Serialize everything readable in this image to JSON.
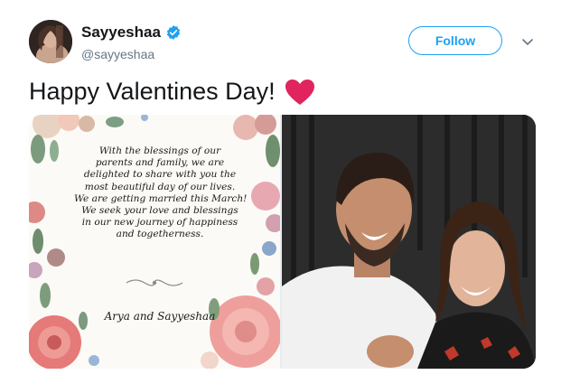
{
  "tweet": {
    "display_name": "Sayyeshaa",
    "handle": "@sayyeshaa",
    "verified": true,
    "follow_label": "Follow",
    "text": "Happy Valentines Day!",
    "emoji": "red-heart-icon"
  },
  "card": {
    "lines": [
      "With the blessings of our",
      "parents and family, we are",
      "delighted to share with you the",
      "most beautiful day of our lives.",
      "We are getting married this March!",
      "We seek your love and blessings",
      "in our new journey of happiness",
      "and togetherness."
    ],
    "signature": "Arya and Sayyeshaa"
  },
  "colors": {
    "accent": "#1da1f2",
    "heart": "#e0245e",
    "text": "#14171a",
    "secondary": "#657786"
  }
}
